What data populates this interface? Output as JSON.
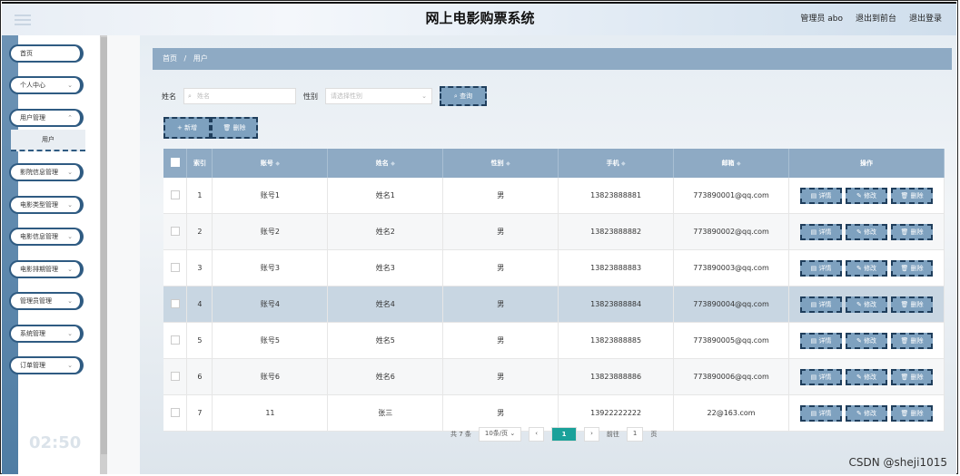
{
  "header": {
    "title": "网上电影购票系统",
    "user": "管理员 abo",
    "to_front": "退出到前台",
    "logout": "退出登录"
  },
  "sidebar": {
    "items": [
      {
        "label": "首页",
        "chev": ""
      },
      {
        "label": "个人中心",
        "chev": "⌄"
      },
      {
        "label": "用户管理",
        "chev": "⌃"
      },
      {
        "label": "影院信息管理",
        "chev": "⌄"
      },
      {
        "label": "电影类型管理",
        "chev": "⌄"
      },
      {
        "label": "电影信息管理",
        "chev": "⌄"
      },
      {
        "label": "电影排期管理",
        "chev": "⌄"
      },
      {
        "label": "管理员管理",
        "chev": "⌄"
      },
      {
        "label": "系统管理",
        "chev": "⌄"
      },
      {
        "label": "订单管理",
        "chev": "⌄"
      }
    ],
    "sub_item": "用户",
    "clock": "02:50"
  },
  "breadcrumb": {
    "home": "首页",
    "sep": "/",
    "current": "用户"
  },
  "search": {
    "name_label": "姓名",
    "name_placeholder": "姓名",
    "gender_label": "性别",
    "gender_placeholder": "请选择性别",
    "query_button": "查询"
  },
  "actions": {
    "add": "新增",
    "delete": "删除"
  },
  "table": {
    "headers": {
      "index": "索引",
      "account": "账号",
      "name": "姓名",
      "gender": "性别",
      "phone": "手机",
      "email": "邮箱",
      "ops": "操作"
    },
    "op_labels": {
      "detail": "详情",
      "edit": "修改",
      "delete": "删除"
    },
    "rows": [
      {
        "index": "1",
        "account": "账号1",
        "name": "姓名1",
        "gender": "男",
        "phone": "13823888881",
        "email": "773890001@qq.com"
      },
      {
        "index": "2",
        "account": "账号2",
        "name": "姓名2",
        "gender": "男",
        "phone": "13823888882",
        "email": "773890002@qq.com"
      },
      {
        "index": "3",
        "account": "账号3",
        "name": "姓名3",
        "gender": "男",
        "phone": "13823888883",
        "email": "773890003@qq.com"
      },
      {
        "index": "4",
        "account": "账号4",
        "name": "姓名4",
        "gender": "男",
        "phone": "13823888884",
        "email": "773890004@qq.com"
      },
      {
        "index": "5",
        "account": "账号5",
        "name": "姓名5",
        "gender": "男",
        "phone": "13823888885",
        "email": "773890005@qq.com"
      },
      {
        "index": "6",
        "account": "账号6",
        "name": "姓名6",
        "gender": "男",
        "phone": "13823888886",
        "email": "773890006@qq.com"
      },
      {
        "index": "7",
        "account": "11",
        "name": "张三",
        "gender": "男",
        "phone": "13922222222",
        "email": "22@163.com"
      }
    ]
  },
  "pagination": {
    "total": "共 7 条",
    "page_size": "10条/页",
    "prev": "‹",
    "current": "1",
    "next": "›",
    "goto_label": "前往",
    "goto_value": "1",
    "page_suffix": "页"
  },
  "watermark": "CSDN @sheji1015",
  "colors": {
    "accent": "#8eaac4",
    "active_page": "#1aa19a",
    "nav_border": "#2f5b82"
  }
}
